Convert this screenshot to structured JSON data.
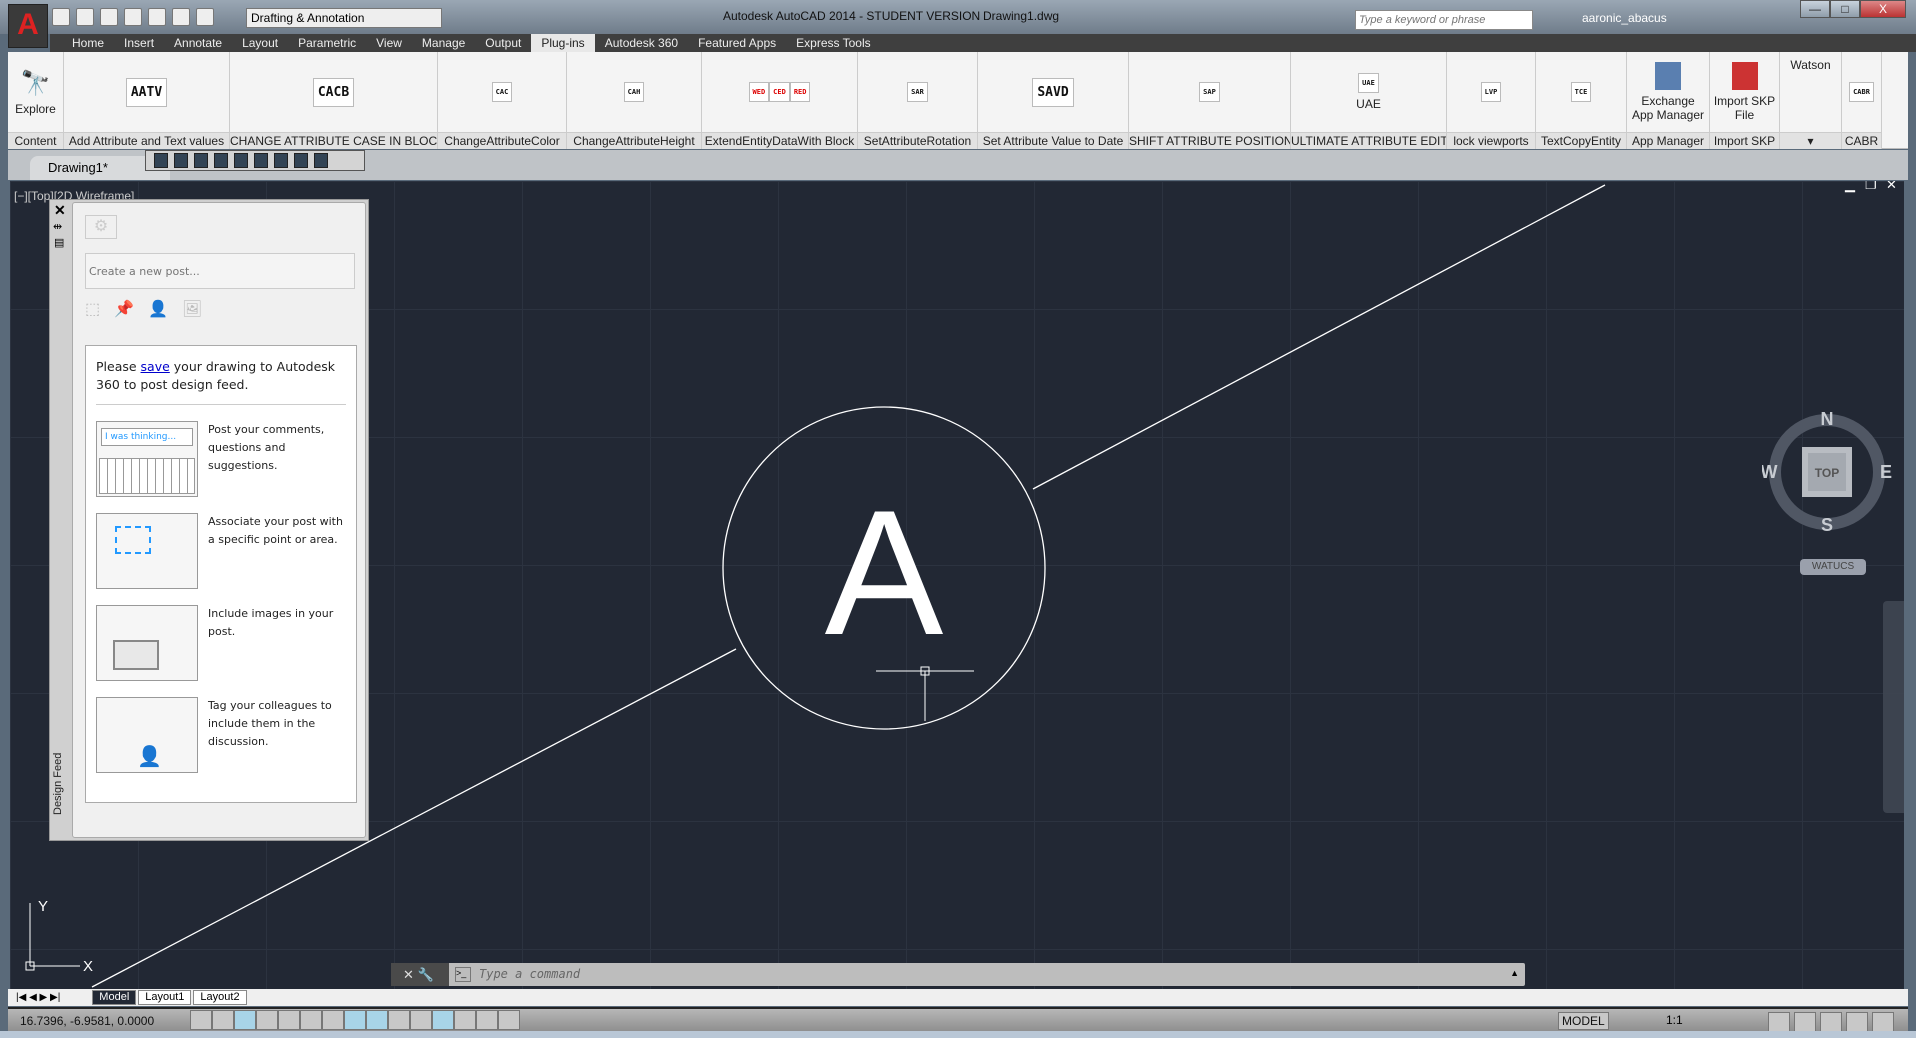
{
  "titlebar": {
    "title": "Autodesk AutoCAD 2014 - STUDENT VERSION",
    "file": "Drawing1.dwg",
    "workspace": "Drafting & Annotation",
    "search_placeholder": "Type a keyword or phrase",
    "user": "aaronic_abacus",
    "minimize": "—",
    "restore": "□",
    "close": "X"
  },
  "ribbon_tabs": [
    {
      "label": "Home"
    },
    {
      "label": "Insert"
    },
    {
      "label": "Annotate"
    },
    {
      "label": "Layout"
    },
    {
      "label": "Parametric"
    },
    {
      "label": "View"
    },
    {
      "label": "Manage"
    },
    {
      "label": "Output"
    },
    {
      "label": "Plug-ins",
      "active": true
    },
    {
      "label": "Autodesk 360"
    },
    {
      "label": "Featured Apps"
    },
    {
      "label": "Express Tools"
    }
  ],
  "panels": [
    {
      "label": "Content",
      "button": "Explore",
      "icon": "binoculars-icon"
    },
    {
      "label": "Add Attribute and Text values",
      "icon_text": "AATV"
    },
    {
      "label": "CHANGE ATTRIBUTE CASE IN BLOCK",
      "icon_text": "CACB"
    },
    {
      "label": "ChangeAttributeColor",
      "icon_text": "CAC"
    },
    {
      "label": "ChangeAttributeHeight",
      "icon_text": "CAH"
    },
    {
      "label": "ExtendEntityDataWith Block",
      "icons": [
        "WED",
        "CED",
        "RED"
      ]
    },
    {
      "label": "SetAttributeRotation",
      "icon_text": "SAR"
    },
    {
      "label": "Set Attribute Value to Date",
      "icon_text": "SAVD"
    },
    {
      "label": "SHIFT ATTRIBUTE POSITION",
      "icon_text": "SAP"
    },
    {
      "label": "ULTIMATE ATTRIBUTE EDIT",
      "icon_text": "UAE",
      "button": "UAE"
    },
    {
      "label": "lock viewports",
      "icon_text": "LVP"
    },
    {
      "label": "TextCopyEntity",
      "icon_text": "TCE"
    },
    {
      "label": "App Manager",
      "button": "Exchange App Manager"
    },
    {
      "label": "Import SKP",
      "button": "Import SKP File"
    },
    {
      "label": "▾",
      "button": "Watson"
    },
    {
      "label": "CABR",
      "icon_text": "CABR"
    }
  ],
  "document_tab": "Drawing1*",
  "viewport": {
    "label": "[−][Top][2D Wireframe]",
    "text_entity": "A",
    "viewcube": {
      "n": "N",
      "s": "S",
      "e": "E",
      "w": "W",
      "face": "TOP"
    },
    "ucs_menu": "WATUCS",
    "ucs_x": "X",
    "ucs_y": "Y"
  },
  "design_feed": {
    "title": "Design Feed",
    "placeholder": "Create a new post...",
    "msg_pre": "Please ",
    "msg_link": "save",
    "msg_post": " your drawing to Autodesk 360 to post design feed.",
    "tip1_sample": "I was thinking...",
    "tips": [
      "Post your comments, questions and suggestions.",
      "Associate your post with a specific point or area.",
      "Include images in your post.",
      "Tag your colleagues to include them in the discussion."
    ]
  },
  "command": {
    "placeholder": "Type  a  command"
  },
  "layout_tabs": [
    {
      "label": "Model",
      "active": true
    },
    {
      "label": "Layout1"
    },
    {
      "label": "Layout2"
    }
  ],
  "status": {
    "coords": "16.7396, -6.9581, 0.0000",
    "model": "MODEL",
    "scale": "1:1"
  }
}
